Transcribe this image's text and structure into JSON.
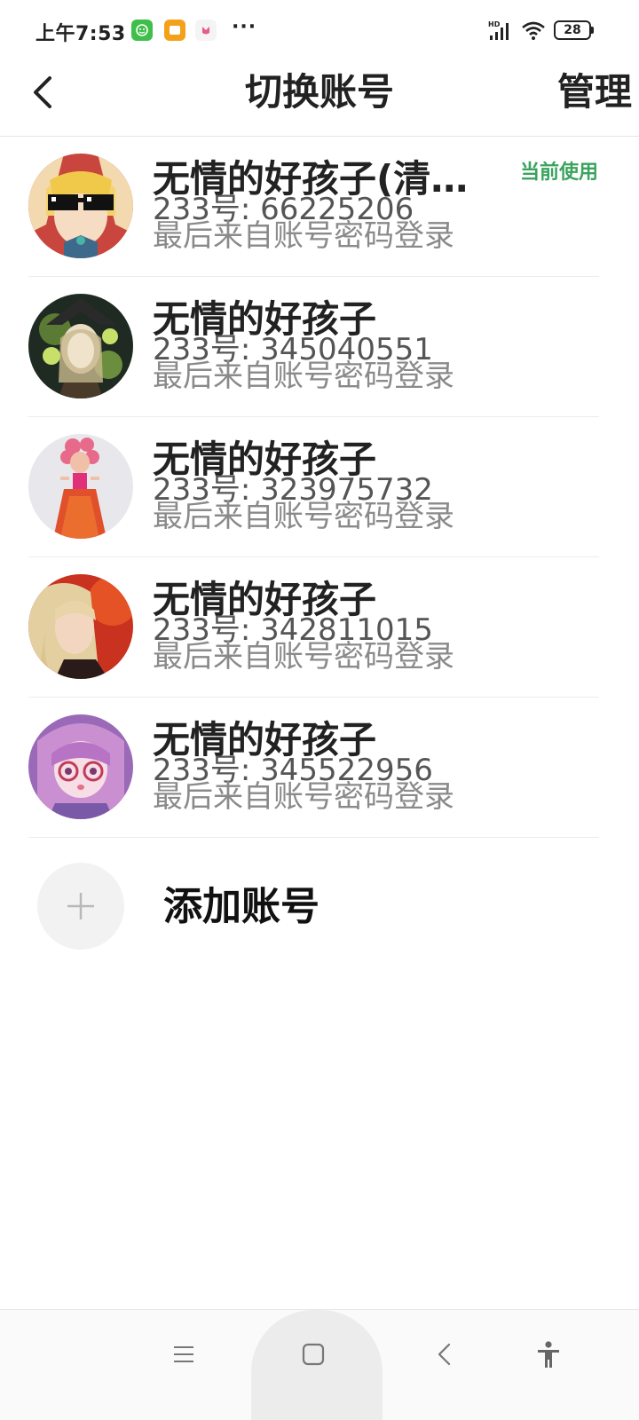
{
  "status_bar": {
    "time": "上午7:53",
    "dots": "···",
    "battery": "28",
    "network_label": "HD"
  },
  "header": {
    "title": "切换账号",
    "manage_label": "管理"
  },
  "accounts": [
    {
      "name": "无情的好孩子(清…",
      "id_text": "233号: 66225206",
      "login_text": "最后来自账号密码登录",
      "badge": "当前使用"
    },
    {
      "name": "无情的好孩子",
      "id_text": "233号: 345040551",
      "login_text": "最后来自账号密码登录"
    },
    {
      "name": "无情的好孩子",
      "id_text": "233号: 323975732",
      "login_text": "最后来自账号密码登录"
    },
    {
      "name": "无情的好孩子",
      "id_text": "233号: 342811015",
      "login_text": "最后来自账号密码登录"
    },
    {
      "name": "无情的好孩子",
      "id_text": "233号: 345522956",
      "login_text": "最后来自账号密码登录"
    }
  ],
  "add_account": {
    "label": "添加账号",
    "icon": "plus-icon"
  },
  "colors": {
    "accent_green": "#3aa35d"
  }
}
